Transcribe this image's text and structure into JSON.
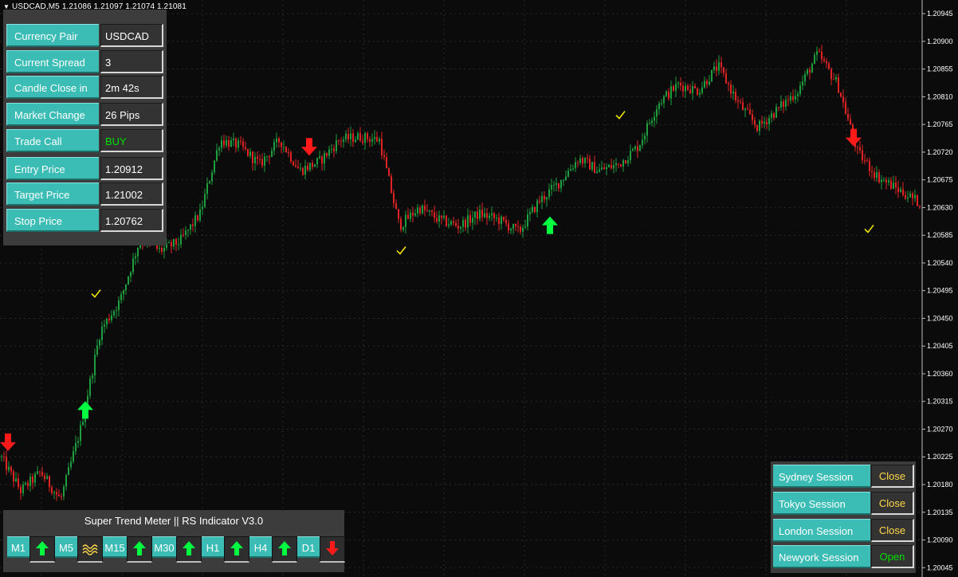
{
  "header": {
    "symbol": "USDCAD,M5",
    "ohlc": "1.21086 1.21097 1.21074 1.21081"
  },
  "info_panel": {
    "rows": [
      {
        "label": "Currency Pair",
        "value": "USDCAD"
      },
      {
        "label": "Current Spread",
        "value": "3"
      },
      {
        "label": "Candle Close in",
        "value": "2m 42s"
      },
      {
        "label": "Market Change",
        "value": "26 Pips"
      },
      {
        "label": "Trade Call",
        "value": "BUY"
      },
      {
        "label": "Entry Price",
        "value": "1.20912"
      },
      {
        "label": "Target Price",
        "value": "1.21002"
      },
      {
        "label": "Stop Price",
        "value": "1.20762"
      }
    ]
  },
  "trend_meter": {
    "title": "Super Trend Meter  ||  RS Indicator V3.0",
    "timeframes": [
      {
        "label": "M1",
        "signal": "up"
      },
      {
        "label": "M5",
        "signal": "flat"
      },
      {
        "label": "M15",
        "signal": "up"
      },
      {
        "label": "M30",
        "signal": "up"
      },
      {
        "label": "H1",
        "signal": "up"
      },
      {
        "label": "H4",
        "signal": "up"
      },
      {
        "label": "D1",
        "signal": "down"
      }
    ]
  },
  "sessions": [
    {
      "label": "Sydney Session",
      "status": "Close"
    },
    {
      "label": "Tokyo Session",
      "status": "Close"
    },
    {
      "label": "London Session",
      "status": "Close"
    },
    {
      "label": "Newyork Session",
      "status": "Open"
    }
  ],
  "colors": {
    "bull": "#1e9e3e",
    "bear": "#e02424",
    "panel_teal": "#3bbdb6",
    "buy_green": "#00e000",
    "close_yellow": "#ffd84a",
    "up_arrow": "#00ff40",
    "down_arrow": "#ff1a1a",
    "check": "#ffee00"
  },
  "chart_data": {
    "type": "line",
    "title": "USDCAD,M5",
    "price_axis_ticks": [
      "1.20945",
      "1.20900",
      "1.20855",
      "1.20810",
      "1.20765",
      "1.20720",
      "1.20675",
      "1.20630",
      "1.20585",
      "1.20540",
      "1.20495",
      "1.20450",
      "1.20405",
      "1.20360",
      "1.20315",
      "1.20270",
      "1.20225",
      "1.20180",
      "1.20135",
      "1.20090",
      "1.20045"
    ],
    "ylim": [
      1.20035,
      1.20962
    ],
    "grid": true,
    "series": [
      {
        "x": [
          0,
          25,
          50,
          75,
          100,
          125,
          150,
          175,
          200,
          225,
          250,
          275,
          300,
          325,
          350,
          375,
          400,
          425,
          450,
          475,
          500,
          525,
          550,
          575,
          600,
          625,
          650,
          675,
          700,
          725,
          750,
          775,
          800,
          825,
          850,
          875,
          900,
          925,
          950,
          975,
          1000,
          1025,
          1050,
          1075,
          1100,
          1125,
          1150
        ],
        "values": [
          1.20225,
          1.2017,
          1.202,
          1.20155,
          1.2027,
          1.2043,
          1.2048,
          1.2058,
          1.2056,
          1.20575,
          1.2062,
          1.2074,
          1.2073,
          1.207,
          1.2074,
          1.2069,
          1.20705,
          1.2074,
          1.20745,
          1.2074,
          1.206,
          1.2063,
          1.2061,
          1.206,
          1.2062,
          1.2061,
          1.2059,
          1.2064,
          1.2067,
          1.2071,
          1.2069,
          1.207,
          1.2073,
          1.208,
          1.2083,
          1.2082,
          1.2086,
          1.208,
          1.2076,
          1.2079,
          1.2082,
          1.2088,
          1.2083,
          1.2072,
          1.2068,
          1.2066,
          1.2064
        ]
      }
    ],
    "signals": [
      {
        "type": "down-arrow",
        "x": 10,
        "price": 1.2025
      },
      {
        "type": "up-arrow",
        "x": 107,
        "price": 1.203
      },
      {
        "type": "check",
        "x": 120,
        "price": 1.2049
      },
      {
        "type": "down-arrow",
        "x": 388,
        "price": 1.2073
      },
      {
        "type": "check",
        "x": 503,
        "price": 1.2056
      },
      {
        "type": "up-arrow",
        "x": 690,
        "price": 1.206
      },
      {
        "type": "check",
        "x": 778,
        "price": 1.2078
      },
      {
        "type": "down-arrow",
        "x": 1071,
        "price": 1.20745
      },
      {
        "type": "check",
        "x": 1090,
        "price": 1.20595
      }
    ]
  }
}
